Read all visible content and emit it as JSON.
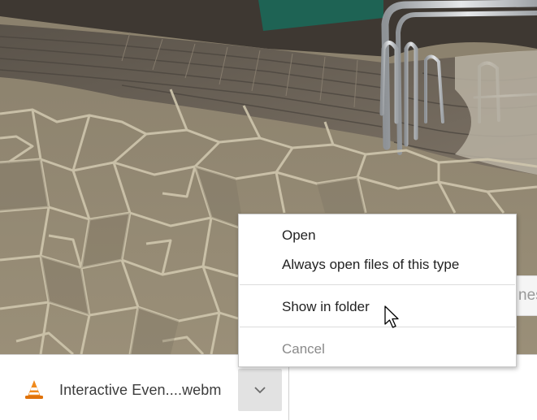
{
  "download": {
    "filename": "Interactive Even....webm",
    "icon": "vlc-cone-icon",
    "arrow_icon": "chevron-down-icon"
  },
  "context_menu": {
    "items": [
      {
        "label": "Open",
        "enabled": true
      },
      {
        "label": "Always open files of this type",
        "enabled": true
      },
      {
        "label": "Show in folder",
        "enabled": true
      },
      {
        "label": "Cancel",
        "enabled": false
      }
    ]
  },
  "partial_button": {
    "label": "nes"
  },
  "colors": {
    "ground": "#8e8470",
    "stone_joint": "#cfc6ad",
    "stairs": "#6e6559",
    "green_panel": "#1e6354",
    "menu_bg": "#ffffff",
    "arrow_bg": "#e2e2e2"
  }
}
